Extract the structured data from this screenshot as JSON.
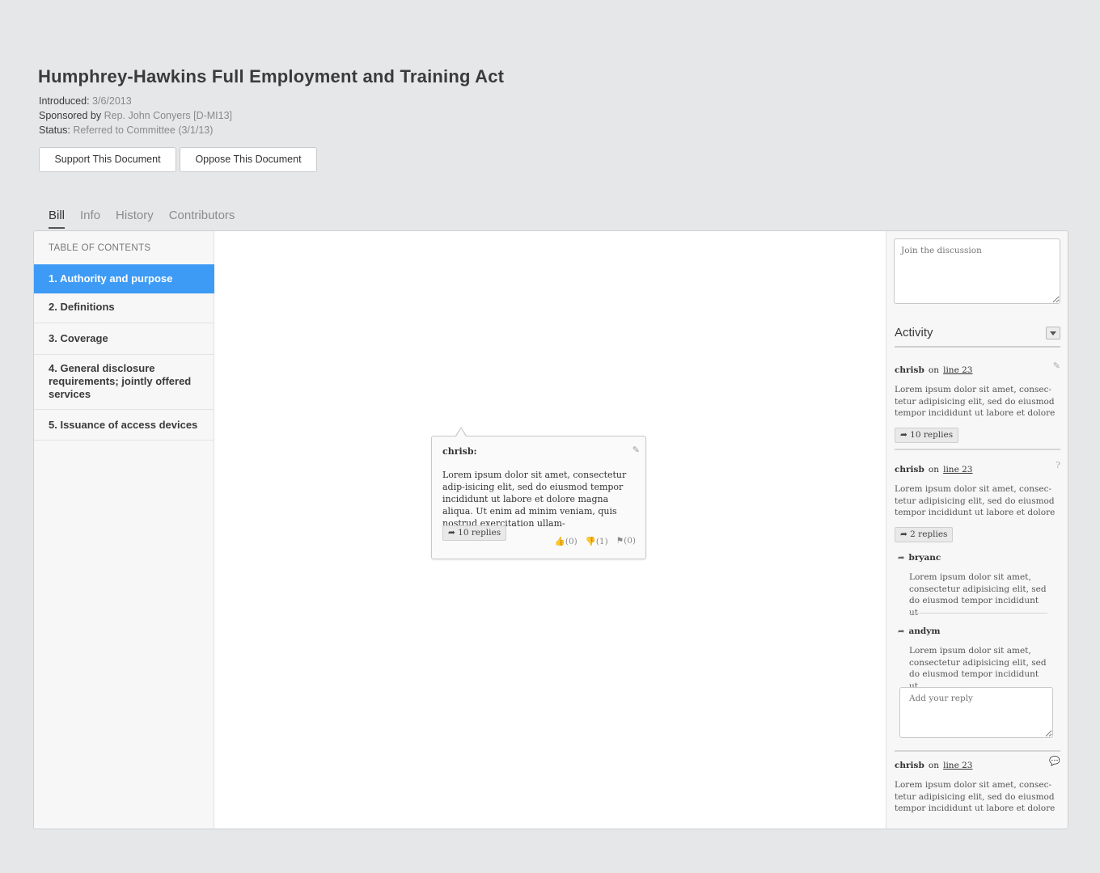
{
  "bill": {
    "title": "Humphrey-Hawkins Full Employment and Training Act",
    "introduced_label": "Introduced:",
    "introduced_value": "3/6/2013",
    "sponsor_label": "Sponsored by",
    "sponsor_value": "Rep. John Conyers [D-MI13]",
    "status_label": "Status:",
    "status_value": "Referred to Committee (3/1/13)"
  },
  "actions": {
    "support": "Support This Document",
    "oppose": "Oppose This Document"
  },
  "tabs": [
    {
      "label": "Bill",
      "active": true
    },
    {
      "label": "Info"
    },
    {
      "label": "History"
    },
    {
      "label": "Contributors"
    }
  ],
  "toc": {
    "heading": "TABLE OF CONTENTS",
    "items": [
      {
        "label": "1. Authority and purpose",
        "active": true
      },
      {
        "label": "2. Definitions"
      },
      {
        "label": "3. Coverage"
      },
      {
        "label": "4. General disclosure requirements; jointly offered services"
      },
      {
        "label": "5. Issuance of access devices"
      }
    ]
  },
  "popup": {
    "user": "chrisb:",
    "body": "Lorem ipsum dolor sit amet, consectetur adip-isicing elit, sed do eiusmod tempor incididunt ut labore et dolore magna aliqua. Ut enim ad minim veniam, quis nostrud exercitation ullam-",
    "replies": "10 replies",
    "likes": "(0)",
    "dislikes": "(1)",
    "flags": "(0)"
  },
  "sidebar": {
    "join_placeholder": "Join the discussion",
    "activity_title": "Activity",
    "entries": [
      {
        "user": "chrisb",
        "on": "on",
        "line": "line 23",
        "body": "Lorem ipsum dolor sit amet, consec-tetur adipisicing elit, sed do eiusmod tempor incididunt ut labore et dolore",
        "replies": "10 replies"
      },
      {
        "user": "chrisb",
        "on": "on",
        "line": "line 23",
        "body": "Lorem ipsum dolor sit amet, consec-tetur adipisicing elit, sed do eiusmod tempor incididunt ut labore et dolore",
        "replies": "2 replies"
      },
      {
        "user": "chrisb",
        "on": "on",
        "line": "line 23",
        "body": "Lorem ipsum dolor sit amet, consec-tetur adipisicing elit, sed do eiusmod tempor incididunt ut labore et dolore"
      }
    ],
    "subreplies": [
      {
        "user": "bryanc",
        "body": "Lorem ipsum dolor sit amet, consectetur adipisicing elit, sed do eiusmod tempor incididunt ut"
      },
      {
        "user": "andym",
        "body": "Lorem ipsum dolor sit amet, consectetur adipisicing elit, sed do eiusmod tempor incididunt ut"
      }
    ],
    "reply_placeholder": "Add your reply"
  }
}
